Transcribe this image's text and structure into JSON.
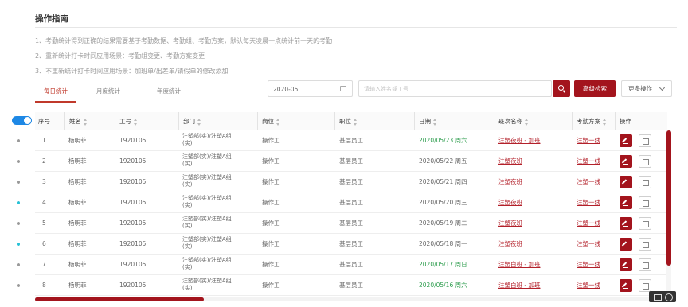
{
  "guide": {
    "title": "操作指南",
    "items": [
      "1、考勤统计得到正确的结果需要基于考勤数据、考勤组、考勤方案，默认每天凌晨一点统计前一天的考勤",
      "2、重新统计打卡时间应用场景：考勤组变更、考勤方案变更",
      "3、不重新统计打卡时间应用场景：加班单/出差单/请假单的修改添加"
    ]
  },
  "tabs": [
    {
      "label": "每日统计",
      "active": true
    },
    {
      "label": "月度统计",
      "active": false
    },
    {
      "label": "年度统计",
      "active": false
    }
  ],
  "filters": {
    "date_value": "2020-05",
    "search_placeholder": "请输入姓名或工号",
    "advanced_label": "高级检索",
    "more_label": "更多操作"
  },
  "table": {
    "headers": {
      "index": "序号",
      "name": "姓名",
      "id": "工号",
      "dept": "部门",
      "post": "岗位",
      "level": "职位",
      "date": "日期",
      "shift": "班次名称",
      "plan": "考勤方案",
      "ops": "操作"
    },
    "rows": [
      {
        "index": "1",
        "name": "杨明菲",
        "id": "1920105",
        "dept": "注塑部(实)/注塑A组(实)",
        "post": "操作工",
        "level": "基层员工",
        "date": "2020/05/23 周六",
        "date_green": true,
        "shift": "注塑夜班 - 加班",
        "plan": "注塑一线",
        "dot": "gray"
      },
      {
        "index": "2",
        "name": "杨明菲",
        "id": "1920105",
        "dept": "注塑部(实)/注塑A组(实)",
        "post": "操作工",
        "level": "基层员工",
        "date": "2020/05/22 周五",
        "date_green": false,
        "shift": "注塑夜班",
        "plan": "注塑一线",
        "dot": "gray"
      },
      {
        "index": "3",
        "name": "杨明菲",
        "id": "1920105",
        "dept": "注塑部(实)/注塑A组(实)",
        "post": "操作工",
        "level": "基层员工",
        "date": "2020/05/21 周四",
        "date_green": false,
        "shift": "注塑夜班",
        "plan": "注塑一线",
        "dot": "gray"
      },
      {
        "index": "4",
        "name": "杨明菲",
        "id": "1920105",
        "dept": "注塑部(实)/注塑A组(实)",
        "post": "操作工",
        "level": "基层员工",
        "date": "2020/05/20 周三",
        "date_green": false,
        "shift": "注塑夜班",
        "plan": "注塑一线",
        "dot": "cyan"
      },
      {
        "index": "5",
        "name": "杨明菲",
        "id": "1920105",
        "dept": "注塑部(实)/注塑A组(实)",
        "post": "操作工",
        "level": "基层员工",
        "date": "2020/05/19 周二",
        "date_green": false,
        "shift": "注塑夜班",
        "plan": "注塑一线",
        "dot": "gray"
      },
      {
        "index": "6",
        "name": "杨明菲",
        "id": "1920105",
        "dept": "注塑部(实)/注塑A组(实)",
        "post": "操作工",
        "level": "基层员工",
        "date": "2020/05/18 周一",
        "date_green": false,
        "shift": "注塑夜班",
        "plan": "注塑一线",
        "dot": "cyan"
      },
      {
        "index": "7",
        "name": "杨明菲",
        "id": "1920105",
        "dept": "注塑部(实)/注塑A组(实)",
        "post": "操作工",
        "level": "基层员工",
        "date": "2020/05/17 周日",
        "date_green": true,
        "shift": "注塑白班 - 加班",
        "plan": "注塑一线",
        "dot": "gray"
      },
      {
        "index": "8",
        "name": "杨明菲",
        "id": "1920105",
        "dept": "注塑部(实)/注塑A组(实)",
        "post": "操作工",
        "level": "基层员工",
        "date": "2020/05/16 周六",
        "date_green": true,
        "shift": "注塑白班 - 加班",
        "plan": "注塑一线",
        "dot": "gray"
      }
    ]
  },
  "colors": {
    "brand": "#a3141d",
    "date_weekend": "#2f9e4f",
    "link": "#b3202a",
    "toggle": "#1e88e5",
    "dot_cyan": "#27c1d6"
  },
  "icons": {
    "calendar": "calendar-icon",
    "search": "search-icon",
    "chevron": "chevron-down-icon",
    "edit": "edit-icon",
    "view": "view-icon"
  }
}
